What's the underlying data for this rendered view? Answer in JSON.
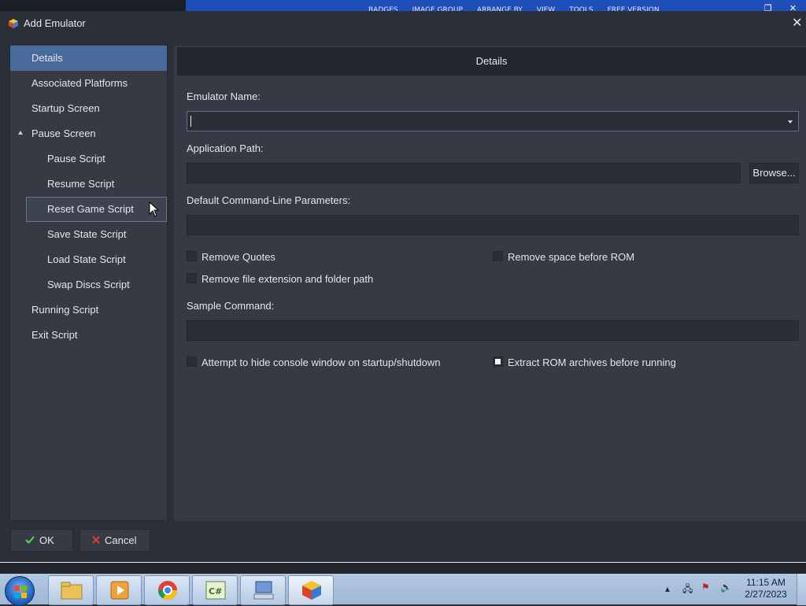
{
  "background_app": {
    "menu": [
      "BADGES",
      "IMAGE GROUP",
      "ARRANGE BY",
      "VIEW",
      "TOOLS",
      "FREE VERSION"
    ]
  },
  "dialog": {
    "title": "Add Emulator",
    "icon": "launchbox-cube-icon"
  },
  "nav": {
    "items": [
      {
        "label": "Details"
      },
      {
        "label": "Associated Platforms"
      },
      {
        "label": "Startup Screen"
      },
      {
        "label": "Pause Screen"
      },
      {
        "label": "Pause Script"
      },
      {
        "label": "Resume Script"
      },
      {
        "label": "Reset Game Script"
      },
      {
        "label": "Save State Script"
      },
      {
        "label": "Load State Script"
      },
      {
        "label": "Swap Discs Script"
      },
      {
        "label": "Running Script"
      },
      {
        "label": "Exit Script"
      }
    ],
    "selected": "Details"
  },
  "panel": {
    "header": "Details",
    "emulator_name_label": "Emulator Name:",
    "emulator_name_value": "",
    "app_path_label": "Application Path:",
    "app_path_value": "",
    "browse_label": "Browse...",
    "cmd_params_label": "Default Command-Line Parameters:",
    "cmd_params_value": "",
    "remove_quotes": {
      "label": "Remove Quotes",
      "checked": false
    },
    "remove_space": {
      "label": "Remove space before ROM",
      "checked": false
    },
    "remove_ext": {
      "label": "Remove file extension and folder path",
      "checked": false
    },
    "sample_label": "Sample Command:",
    "sample_value": "",
    "hide_console": {
      "label": "Attempt to hide console window on startup/shutdown",
      "checked": false
    },
    "extract_rom": {
      "label": "Extract ROM archives before running",
      "checked": true
    }
  },
  "footer": {
    "ok_label": "OK",
    "cancel_label": "Cancel"
  },
  "taskbar": {
    "apps": [
      "explorer",
      "media-player",
      "chrome",
      "csharp-ide",
      "remote-desktop",
      "launchbox"
    ],
    "time": "11:15 AM",
    "date": "2/27/2023"
  },
  "colors": {
    "dialog_bg": "#2b2f38",
    "panel_bg": "#353a45",
    "selected": "#4b6a9c",
    "field_bg": "#2a2e36"
  }
}
